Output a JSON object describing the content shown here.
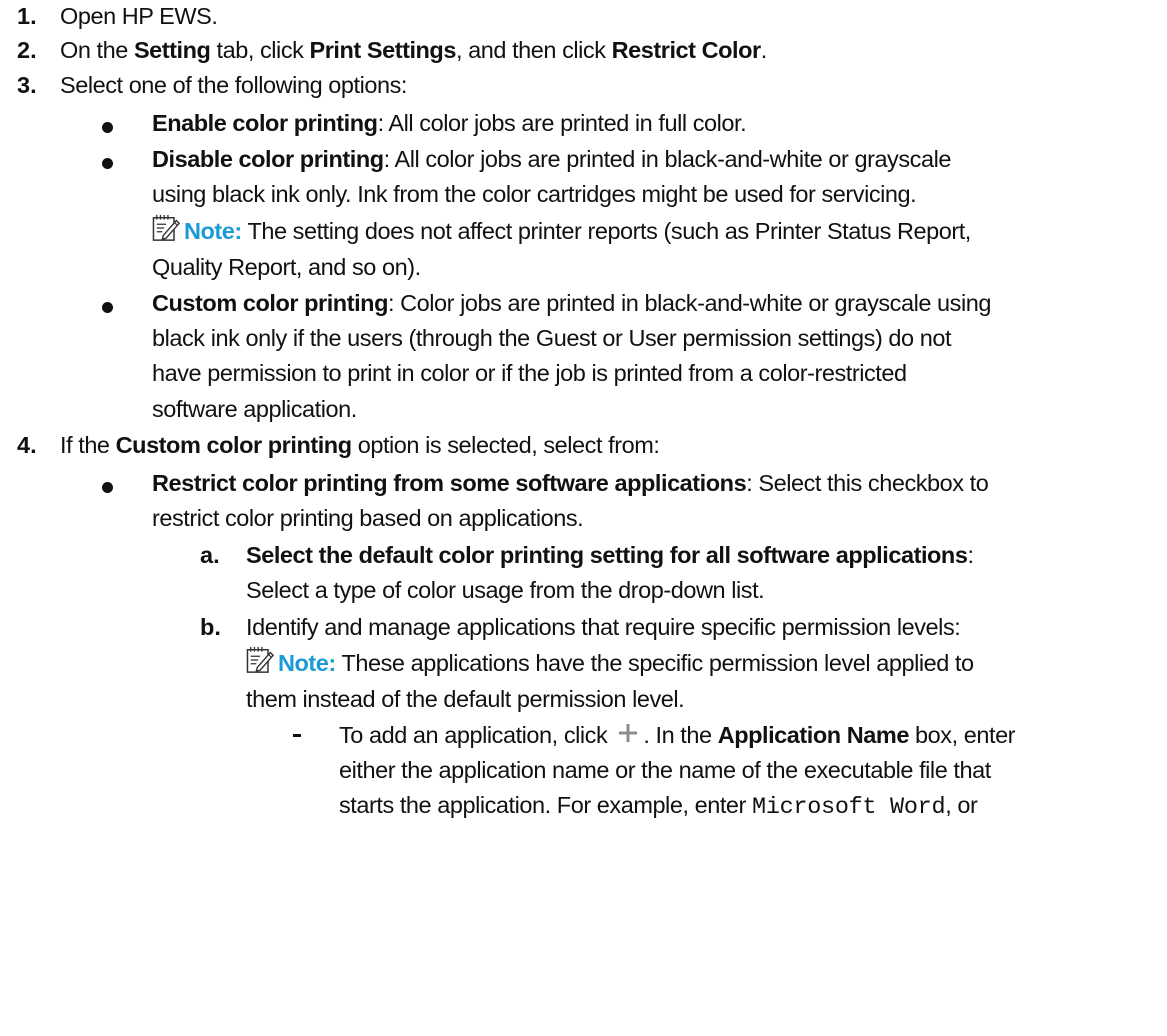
{
  "steps": [
    {
      "num": "1.",
      "parts": [
        "Open HP EWS."
      ]
    },
    {
      "num": "2.",
      "parts": [
        "On the ",
        "Setting",
        " tab, click ",
        "Print Settings",
        ", and then click ",
        "Restrict Color",
        "."
      ]
    },
    {
      "num": "3.",
      "parts": [
        "Select one of the following options:"
      ]
    },
    {
      "num": "4.",
      "parts": [
        "If the ",
        "Custom color printing",
        " option is selected, select from:"
      ]
    }
  ],
  "options": {
    "enable": {
      "title": "Enable color printing",
      "text": ": All color jobs are printed in full color."
    },
    "disable": {
      "title": "Disable color printing",
      "line1": ": All color jobs are printed in black-and-white or grayscale",
      "line2": "using black ink only. Ink from the color cartridges might be used for servicing."
    },
    "custom": {
      "title": "Custom color printing",
      "line1": ": Color jobs are printed in black-and-white or grayscale using",
      "line2": "black ink only if the users (through the Guest or User permission settings) do not",
      "line3": "have permission to print in color or if the job is printed from a color-restricted",
      "line4": "software application."
    }
  },
  "note1": {
    "label": "Note:",
    "line1": " The setting does not affect printer reports (such as Printer Status Report,",
    "line2": "Quality Report, and so on)."
  },
  "restrict": {
    "title": "Restrict color printing from some software applications",
    "line1": ": Select this checkbox to",
    "line2": "restrict color printing based on applications."
  },
  "substeps": {
    "a": {
      "letter": "a.",
      "title": "Select the default color printing setting for all software applications",
      "colon": ":",
      "line2": "Select a type of color usage from the drop-down list."
    },
    "b": {
      "letter": "b.",
      "line1": "Identify and manage applications that require specific permission levels:"
    }
  },
  "note2": {
    "label": "Note:",
    "line1": " These applications have the specific permission level applied to",
    "line2": "them instead of the default permission level."
  },
  "add_app": {
    "line1_pre": "To add an application, click ",
    "line1_post": ". In the ",
    "field": "Application Name",
    "line1_end": " box, enter",
    "line2": "either the application name or the name of the executable file that",
    "line3_pre": "starts the application. For example, enter ",
    "example": "Microsoft Word",
    "line3_post": ", or"
  },
  "icons": [
    "note-icon",
    "plus-icon"
  ],
  "colors": {
    "text": "#111111",
    "note_label": "#1a9ad6",
    "plus_icon": "#8c8c8c"
  }
}
